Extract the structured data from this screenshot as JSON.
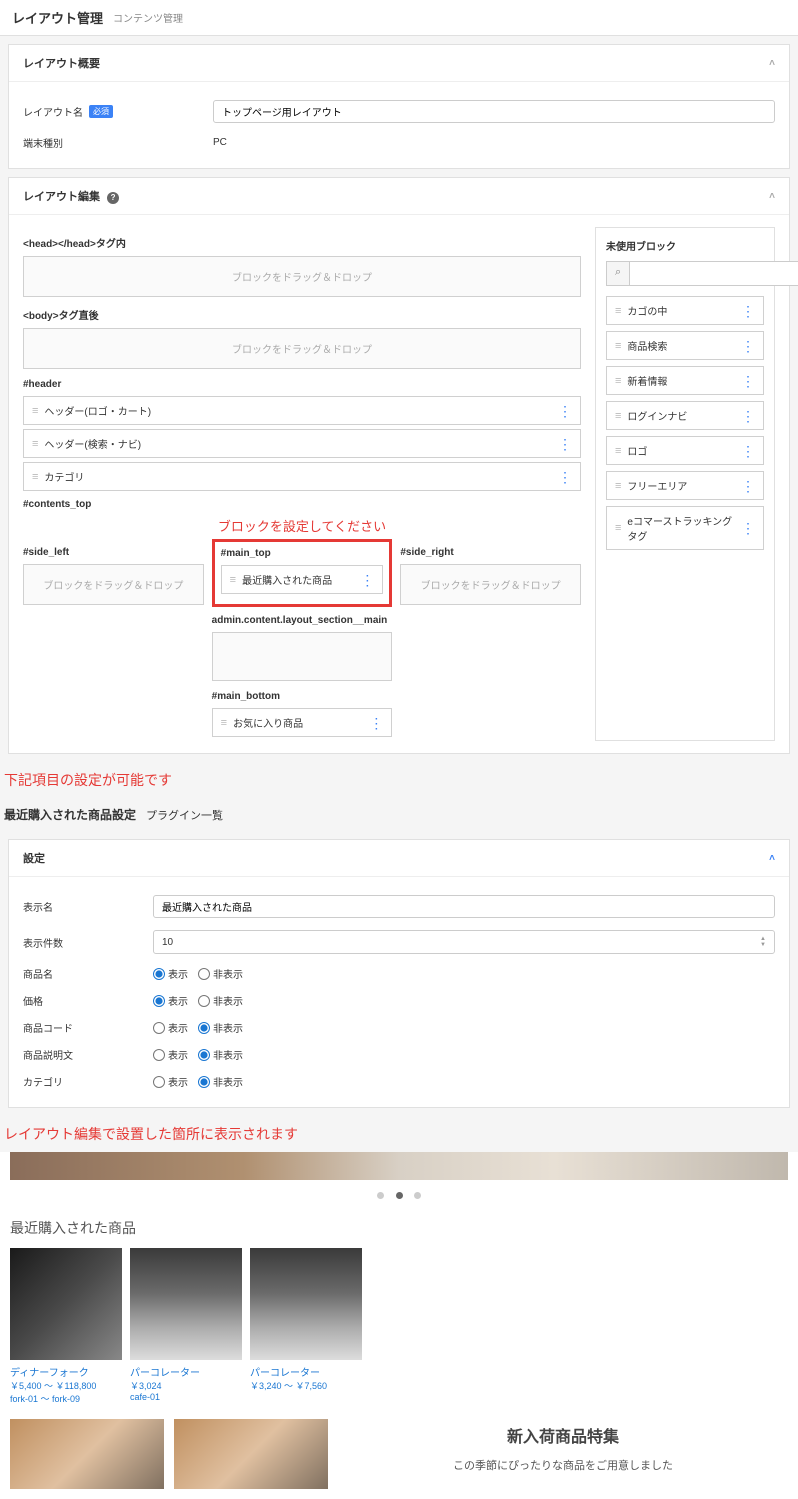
{
  "header": {
    "title": "レイアウト管理",
    "sub": "コンテンツ管理"
  },
  "overview": {
    "panel_title": "レイアウト概要",
    "name_label": "レイアウト名",
    "badge": "必須",
    "name_value": "トップページ用レイアウト",
    "device_label": "端末種別",
    "device_value": "PC"
  },
  "editor": {
    "panel_title": "レイアウト編集",
    "head_label": "<head></head>タグ内",
    "body_label": "<body>タグ直後",
    "drop_text": "ブロックをドラッグ＆ドロップ",
    "header_section": "#header",
    "header_blocks": [
      "ヘッダー(ロゴ・カート)",
      "ヘッダー(検索・ナビ)",
      "カテゴリ"
    ],
    "contents_top": "#contents_top",
    "red_note": "ブロックを設定してください",
    "side_left": "#side_left",
    "side_right": "#side_right",
    "main_top": "#main_top",
    "main_top_block": "最近購入された商品",
    "main_section": "admin.content.layout_section__main",
    "main_bottom": "#main_bottom",
    "main_bottom_block": "お気に入り商品",
    "unused_title": "未使用ブロック",
    "unused": [
      "カゴの中",
      "商品検索",
      "新着情報",
      "ログインナビ",
      "ロゴ",
      "フリーエリア",
      "eコマーストラッキングタグ"
    ]
  },
  "note1": "下記項目の設定が可能です",
  "settings": {
    "title": "最近購入された商品設定",
    "sub": "プラグイン一覧",
    "panel_title": "設定",
    "display_name_label": "表示名",
    "display_name_value": "最近購入された商品",
    "count_label": "表示件数",
    "count_value": "10",
    "show": "表示",
    "hide": "非表示",
    "rows": [
      {
        "label": "商品名",
        "show": true
      },
      {
        "label": "価格",
        "show": true
      },
      {
        "label": "商品コード",
        "show": false
      },
      {
        "label": "商品説明文",
        "show": false
      },
      {
        "label": "カテゴリ",
        "show": false
      }
    ]
  },
  "note2": "レイアウト編集で設置した箇所に表示されます",
  "front": {
    "section_title": "最近購入された商品",
    "products": [
      {
        "name": "ディナーフォーク",
        "price": "￥5,400 〜 ￥118,800",
        "code": "fork-01 〜 fork-09",
        "img": "fork"
      },
      {
        "name": "パーコレーター",
        "price": "￥3,024",
        "code": "cafe-01",
        "img": "pot"
      },
      {
        "name": "パーコレーター",
        "price": "￥3,240 〜 ￥7,560",
        "code": "",
        "img": "pot"
      }
    ],
    "promo_title": "新入荷商品特集",
    "promo_sub": "この季節にぴったりな商品をご用意しました"
  }
}
